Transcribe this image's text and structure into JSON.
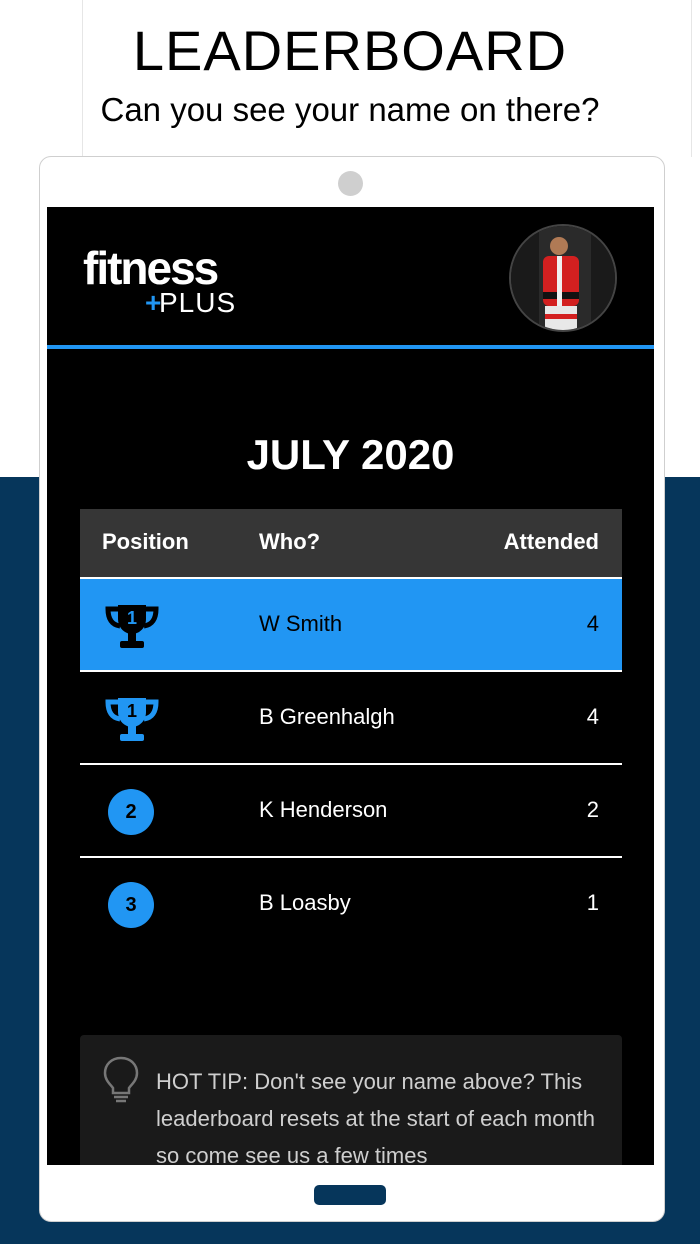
{
  "page": {
    "title": "LEADERBOARD",
    "subtitle": "Can you see your name on there?"
  },
  "app": {
    "logo_word": "fitness",
    "logo_plus": "PLUS",
    "month": "JULY 2020"
  },
  "table": {
    "headers": {
      "position": "Position",
      "who": "Who?",
      "attended": "Attended"
    },
    "rows": [
      {
        "position": "1",
        "icon": "trophy-icon",
        "name": "W Smith",
        "attended": "4",
        "highlight": true
      },
      {
        "position": "1",
        "icon": "trophy-icon",
        "name": "B Greenhalgh",
        "attended": "4",
        "highlight": false
      },
      {
        "position": "2",
        "icon": "badge",
        "name": "K Henderson",
        "attended": "2",
        "highlight": false
      },
      {
        "position": "3",
        "icon": "badge",
        "name": "B Loasby",
        "attended": "1",
        "highlight": false
      }
    ]
  },
  "tip": {
    "icon": "lightbulb-icon",
    "text": "HOT TIP: Don't see your name above? This leaderboard resets at the start of each month so come see us a few times"
  },
  "colors": {
    "accent": "#2196f3",
    "navy": "#06365b",
    "header_bg": "#363636"
  }
}
